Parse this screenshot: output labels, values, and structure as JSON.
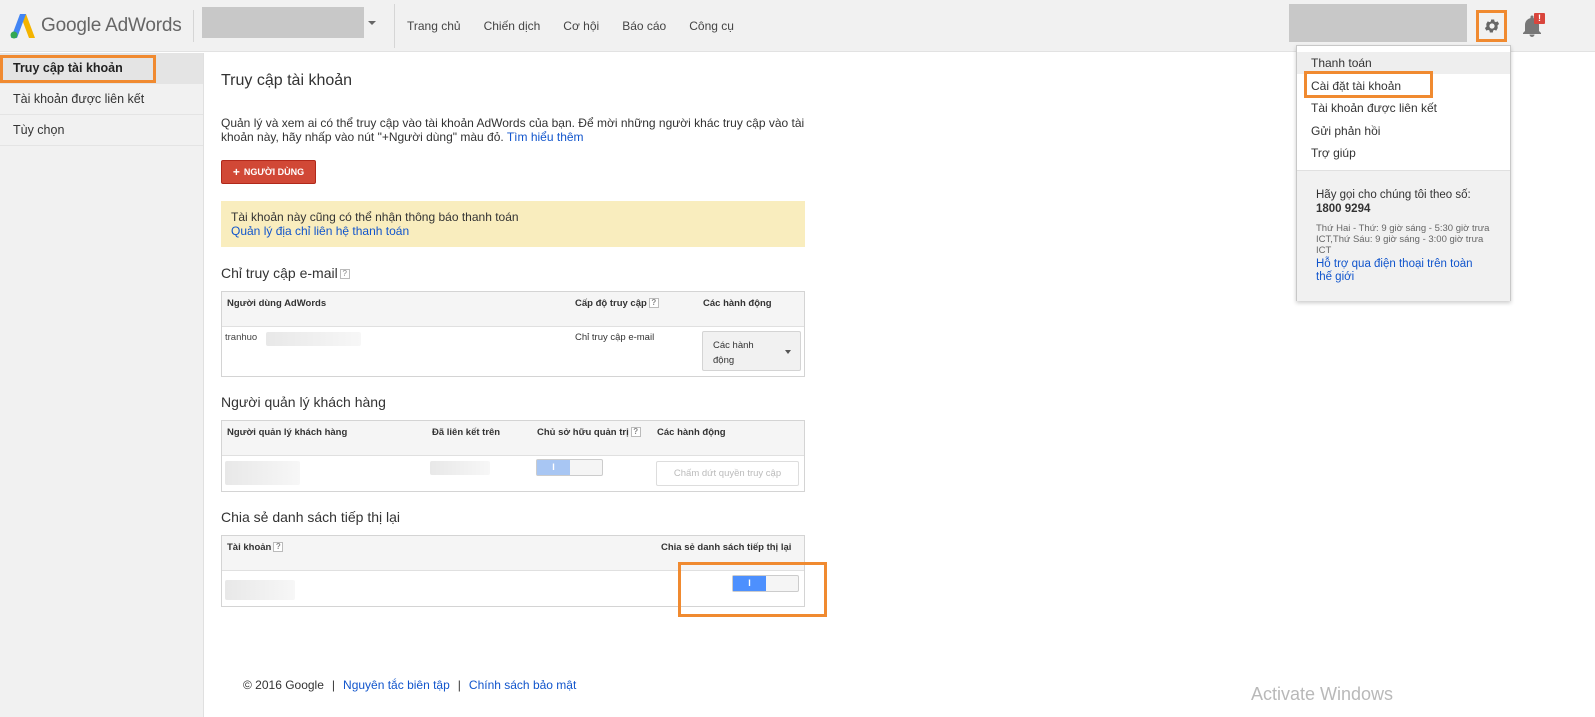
{
  "brand": {
    "logo_text": "Google AdWords",
    "accent_orange": "#f08a30",
    "red_button": "#d14836",
    "link_blue": "#1155cc"
  },
  "topnav": {
    "items": [
      "Trang chủ",
      "Chiến dịch",
      "Cơ hội",
      "Báo cáo",
      "Công cụ"
    ]
  },
  "notifications": {
    "badge": "!"
  },
  "sidebar": {
    "items": [
      {
        "label": "Truy cập tài khoản",
        "active": true
      },
      {
        "label": "Tài khoản được liên kết",
        "active": false
      },
      {
        "label": "Tùy chọn",
        "active": false
      }
    ]
  },
  "main": {
    "title": "Truy cập tài khoản",
    "intro_line1": "Quản lý và xem ai có thể truy cập vào tài khoản AdWords của bạn. Để mời những người khác truy cập vào tài",
    "intro_line2": "khoản này, hãy nhấp vào nút \"+Người dùng\" màu đỏ. ",
    "intro_link": "Tìm hiểu thêm",
    "add_user_plus": "+",
    "add_user_label": "NGƯỜI DÙNG",
    "notice_text": "Tài khoản này cũng có thể nhận thông báo thanh toán",
    "notice_link": "Quản lý địa chỉ liên hệ thanh toán"
  },
  "email_access": {
    "title": "Chỉ truy cập e-mail",
    "help": "?",
    "columns": [
      "Người dùng AdWords",
      "Cấp độ truy cập",
      "Các hành động"
    ],
    "rows": [
      {
        "user": "tranhuo",
        "access": "Chỉ truy cập e-mail",
        "action_line1": "Các hành",
        "action_line2": "động"
      }
    ]
  },
  "client_managers": {
    "title": "Người quản lý khách hàng",
    "columns": [
      "Người quản lý khách hàng",
      "Đã liên kết trên",
      "Chủ sở hữu quản trị",
      "Các hành động"
    ],
    "rows": [
      {
        "toggle_label": "I",
        "toggle_on": true,
        "action": "Chấm dứt quyền truy cập"
      }
    ]
  },
  "remarketing": {
    "title": "Chia sẻ danh sách tiếp thị lại",
    "columns": [
      "Tài khoản",
      "Chia sẻ danh sách tiếp thị lại"
    ],
    "rows": [
      {
        "toggle_label": "I",
        "toggle_on": true
      }
    ]
  },
  "footer": {
    "copyright": "© 2016 Google",
    "sep": "|",
    "link1": "Nguyên tắc biên tập",
    "link2": "Chính sách bảo mật"
  },
  "watermark": "Activate Windows",
  "settings_menu": {
    "items": [
      {
        "label": "Thanh toán"
      },
      {
        "label": "Cài đặt tài khoản"
      },
      {
        "label": "Tài khoản được liên kết"
      },
      {
        "label": "Gửi phản hồi"
      },
      {
        "label": "Trợ giúp"
      }
    ],
    "call_us": "Hãy gọi cho chúng tôi theo số:",
    "phone": "1800 9294",
    "hours": "Thứ Hai - Thứ: 9 giờ sáng - 5:30 giờ trưa ICT,Thứ Sáu: 9 giờ sáng - 3:00 giờ trưa ICT",
    "support_link": "Hỗ trợ qua điện thoại trên toàn thế giới"
  }
}
